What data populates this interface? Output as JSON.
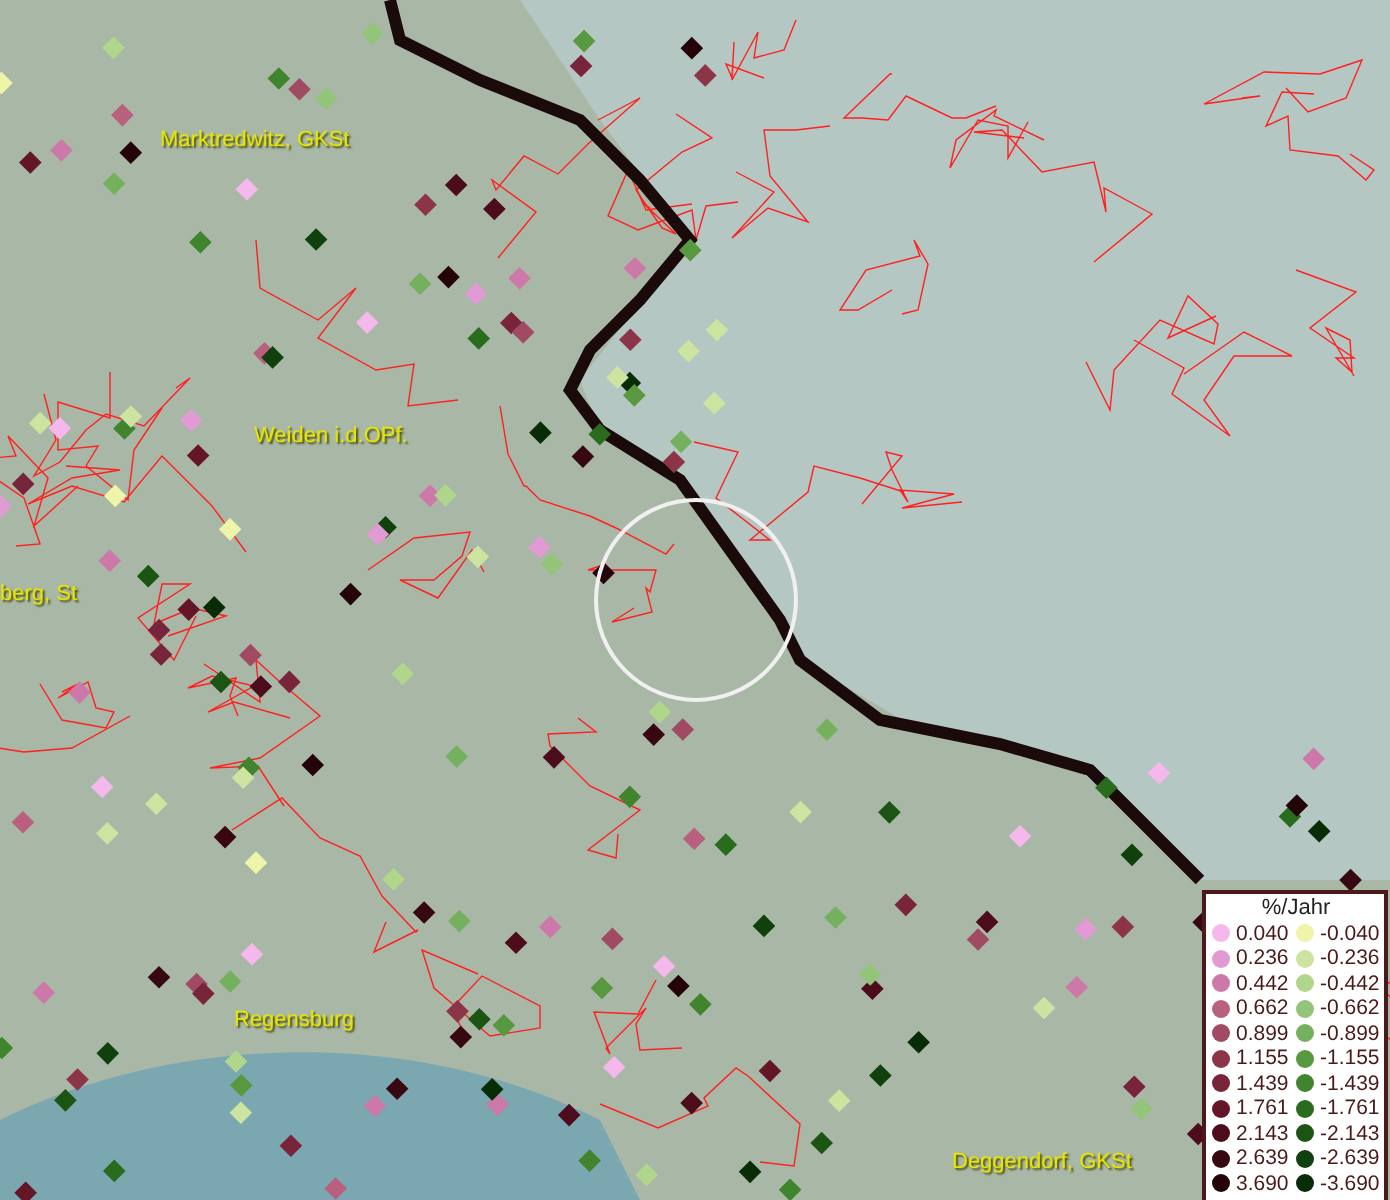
{
  "map": {
    "places": [
      {
        "name": "Marktredwitz, GKSt"
      },
      {
        "name": "Weiden i.d.OPf."
      },
      {
        "name": "berg, St"
      },
      {
        "name": "Regensburg"
      },
      {
        "name": "Deggendorf, GKSt"
      }
    ]
  },
  "legend": {
    "title": "%/Jahr",
    "rows": [
      {
        "positive": {
          "value": "0.040",
          "color": "#f4b8ec"
        },
        "negative": {
          "value": "-0.040",
          "color": "#eef4a8"
        }
      },
      {
        "positive": {
          "value": "0.236",
          "color": "#e29ad4"
        },
        "negative": {
          "value": "-0.236",
          "color": "#cce4a0"
        }
      },
      {
        "positive": {
          "value": "0.442",
          "color": "#cc78a8"
        },
        "negative": {
          "value": "-0.442",
          "color": "#b0d68c"
        }
      },
      {
        "positive": {
          "value": "0.662",
          "color": "#b8607e"
        },
        "negative": {
          "value": "-0.662",
          "color": "#92c47a"
        }
      },
      {
        "positive": {
          "value": "0.899",
          "color": "#a04a64"
        },
        "negative": {
          "value": "-0.899",
          "color": "#74b05e"
        }
      },
      {
        "positive": {
          "value": "1.155",
          "color": "#8c3448"
        },
        "negative": {
          "value": "-1.155",
          "color": "#58983e"
        }
      },
      {
        "positive": {
          "value": "1.439",
          "color": "#78243a"
        },
        "negative": {
          "value": "-1.439",
          "color": "#40842e"
        }
      },
      {
        "positive": {
          "value": "1.761",
          "color": "#641628"
        },
        "negative": {
          "value": "-1.761",
          "color": "#2a6c1e"
        }
      },
      {
        "positive": {
          "value": "2.143",
          "color": "#4c0c1c"
        },
        "negative": {
          "value": "-2.143",
          "color": "#1c5414"
        }
      },
      {
        "positive": {
          "value": "2.639",
          "color": "#380812"
        },
        "negative": {
          "value": "-2.639",
          "color": "#10400c"
        }
      },
      {
        "positive": {
          "value": "3.690",
          "color": "#240408"
        },
        "negative": {
          "value": "-3.690",
          "color": "#082c06"
        }
      }
    ]
  }
}
